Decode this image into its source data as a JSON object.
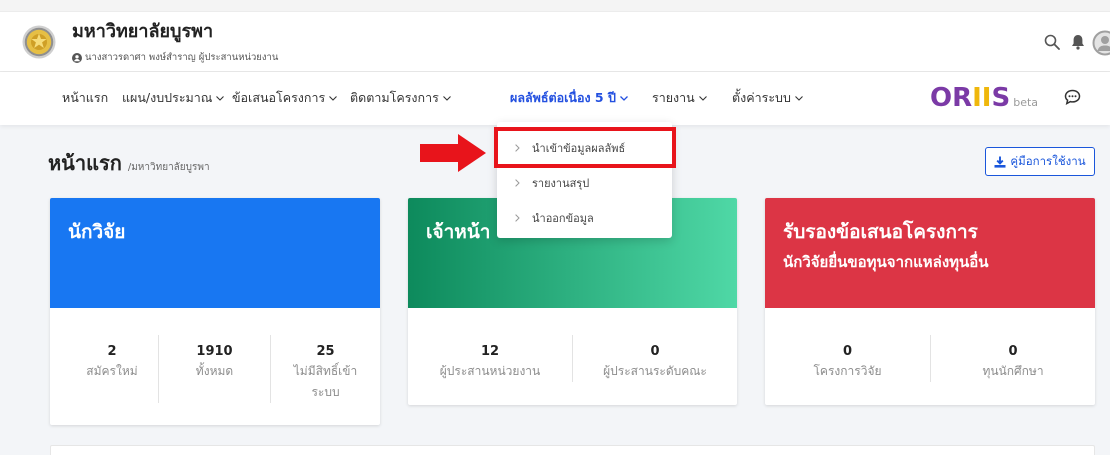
{
  "header": {
    "org_name": "มหาวิทยาลัยบูรพา",
    "user_line": "นางสาวรดาศา พงษ์สำราญ ผู้ประสานหน่วยงาน",
    "logo_icon": "university-seal-logo",
    "user_icon": "user-circle-icon",
    "search_icon": "search-icon",
    "bell_icon": "bell-icon",
    "avatar_icon": "avatar-icon"
  },
  "nav": {
    "items": [
      {
        "label": "หน้าแรก",
        "dropdown": false
      },
      {
        "label": "แผน/งบประมาณ",
        "dropdown": true
      },
      {
        "label": "ข้อเสนอโครงการ",
        "dropdown": true
      },
      {
        "label": "ติดตามโครงการ",
        "dropdown": true
      },
      {
        "label": "ผลลัพธ์ต่อเนื่อง 5 ปี",
        "dropdown": true,
        "active": true
      },
      {
        "label": "รายงาน",
        "dropdown": true
      },
      {
        "label": "ตั้งค่าระบบ",
        "dropdown": true
      }
    ],
    "active_color": "#2350e0",
    "brand": {
      "parts": [
        {
          "text": "OR",
          "color": "#7b3aa6"
        },
        {
          "text": "II",
          "color": "#efb70c"
        },
        {
          "text": "S",
          "color": "#7b3aa6"
        }
      ],
      "tag": "beta"
    },
    "chat_icon": "chat-bubble-icon"
  },
  "dropdown": {
    "items": [
      {
        "label": "นำเข้าข้อมูลผลลัพธ์",
        "highlighted": true
      },
      {
        "label": "รายงานสรุป"
      },
      {
        "label": "นำออกข้อมูล"
      }
    ],
    "item_icon": "chevron-right-icon",
    "highlight_color": "#e8141b"
  },
  "annotation": {
    "arrow_icon": "red-arrow-icon",
    "color": "#e8141b"
  },
  "page": {
    "title": "หน้าแรก",
    "breadcrumb": "/มหาวิทยาลัยบูรพา",
    "manual_button": {
      "label": "คู่มือการใช้งาน",
      "icon": "download-icon",
      "color": "#1a56db"
    }
  },
  "cards": [
    {
      "title": "นักวิจัย",
      "color": "#1877f2",
      "stats": [
        {
          "value": "2",
          "label": "สมัครใหม่"
        },
        {
          "value": "1910",
          "label": "ทั้งหมด"
        },
        {
          "value": "25",
          "label": "ไม่มีสิทธิ์เข้าระบบ"
        }
      ]
    },
    {
      "title": "เจ้าหน้า",
      "color": "#0d8a5c",
      "color_end": "#4fd8a6",
      "stats": [
        {
          "value": "12",
          "label": "ผู้ประสานหน่วยงาน"
        },
        {
          "value": "0",
          "label": "ผู้ประสานระดับคณะ"
        }
      ]
    },
    {
      "title": "รับรองข้อเสนอโครงการ",
      "subtitle": "นักวิจัยยื่นขอทุนจากแหล่งทุนอื่น",
      "color": "#dc3545",
      "stats": [
        {
          "value": "0",
          "label": "โครงการวิจัย"
        },
        {
          "value": "0",
          "label": "ทุนนักศึกษา"
        }
      ]
    }
  ]
}
